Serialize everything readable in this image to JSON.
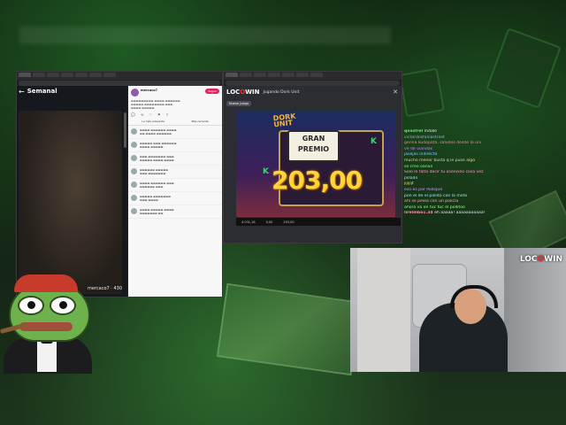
{
  "twitter": {
    "title": "Semanal",
    "photo_caption": "mercaco7 · 430",
    "profile_name": "mercaco7",
    "follow_label": "Seguir",
    "tabs": [
      "Lo más relevante",
      "Más reciente"
    ],
    "comments_count": 7
  },
  "slot": {
    "brand_pre": "LOC",
    "brand_o": "O",
    "brand_post": "WIN",
    "playing_label": "Jugando Dork Unit",
    "back_label": "Nuevo juego",
    "game_title_1": "DORK",
    "game_title_2": "UNIT",
    "gran_1": "GRAN",
    "gran_2": "PREMIO",
    "win_amount": "203,00",
    "bar_balance": "4.031,18",
    "bar_bet": "0,00",
    "bar_total": "203,00"
  },
  "chat": [
    {
      "user": "qeasfrel",
      "color": "#7bd67b",
      "msg": "mdale"
    },
    {
      "user": "",
      "color": "#9ad",
      "msg": "victordosfanlastreet"
    },
    {
      "user": "",
      "color": "#e88",
      "msg": "genna kudopata, saludos desde la uni"
    },
    {
      "user": "",
      "color": "#b8f",
      "msg": "ve de viandas"
    },
    {
      "user": "",
      "color": "#8cf",
      "msg": "jasejas indirecta"
    },
    {
      "user": "",
      "color": "#fc8",
      "msg": "mucho menor busta q le puse algo"
    },
    {
      "user": "",
      "color": "#8f8",
      "msg": "se creo oanan"
    },
    {
      "user": "",
      "color": "#f9c",
      "msg": "Solo le falta decir tu asencieo cosa vez"
    },
    {
      "user": "",
      "color": "#9df",
      "msg": "pillado"
    },
    {
      "user": "",
      "color": "#fd7",
      "msg": "jijijijt"
    },
    {
      "user": "",
      "color": "#c9f",
      "msg": "eso es por Pollopol"
    },
    {
      "user": "",
      "color": "#8ef",
      "msg": "pon el de el pollito con la moto"
    },
    {
      "user": "",
      "color": "#fa9",
      "msg": "ahí se pelea con un policía"
    },
    {
      "user": "",
      "color": "#9f9",
      "msg": "ahora va en tuc tuc el pollitoo"
    },
    {
      "user": "lirelmba1.34",
      "color": "#f8a",
      "msg": "eh aaaaa! aaaaaaaaaaa!"
    }
  ],
  "webcam": {
    "brand_pre": "LOC",
    "brand_o": "O",
    "brand_post": "WIN"
  }
}
